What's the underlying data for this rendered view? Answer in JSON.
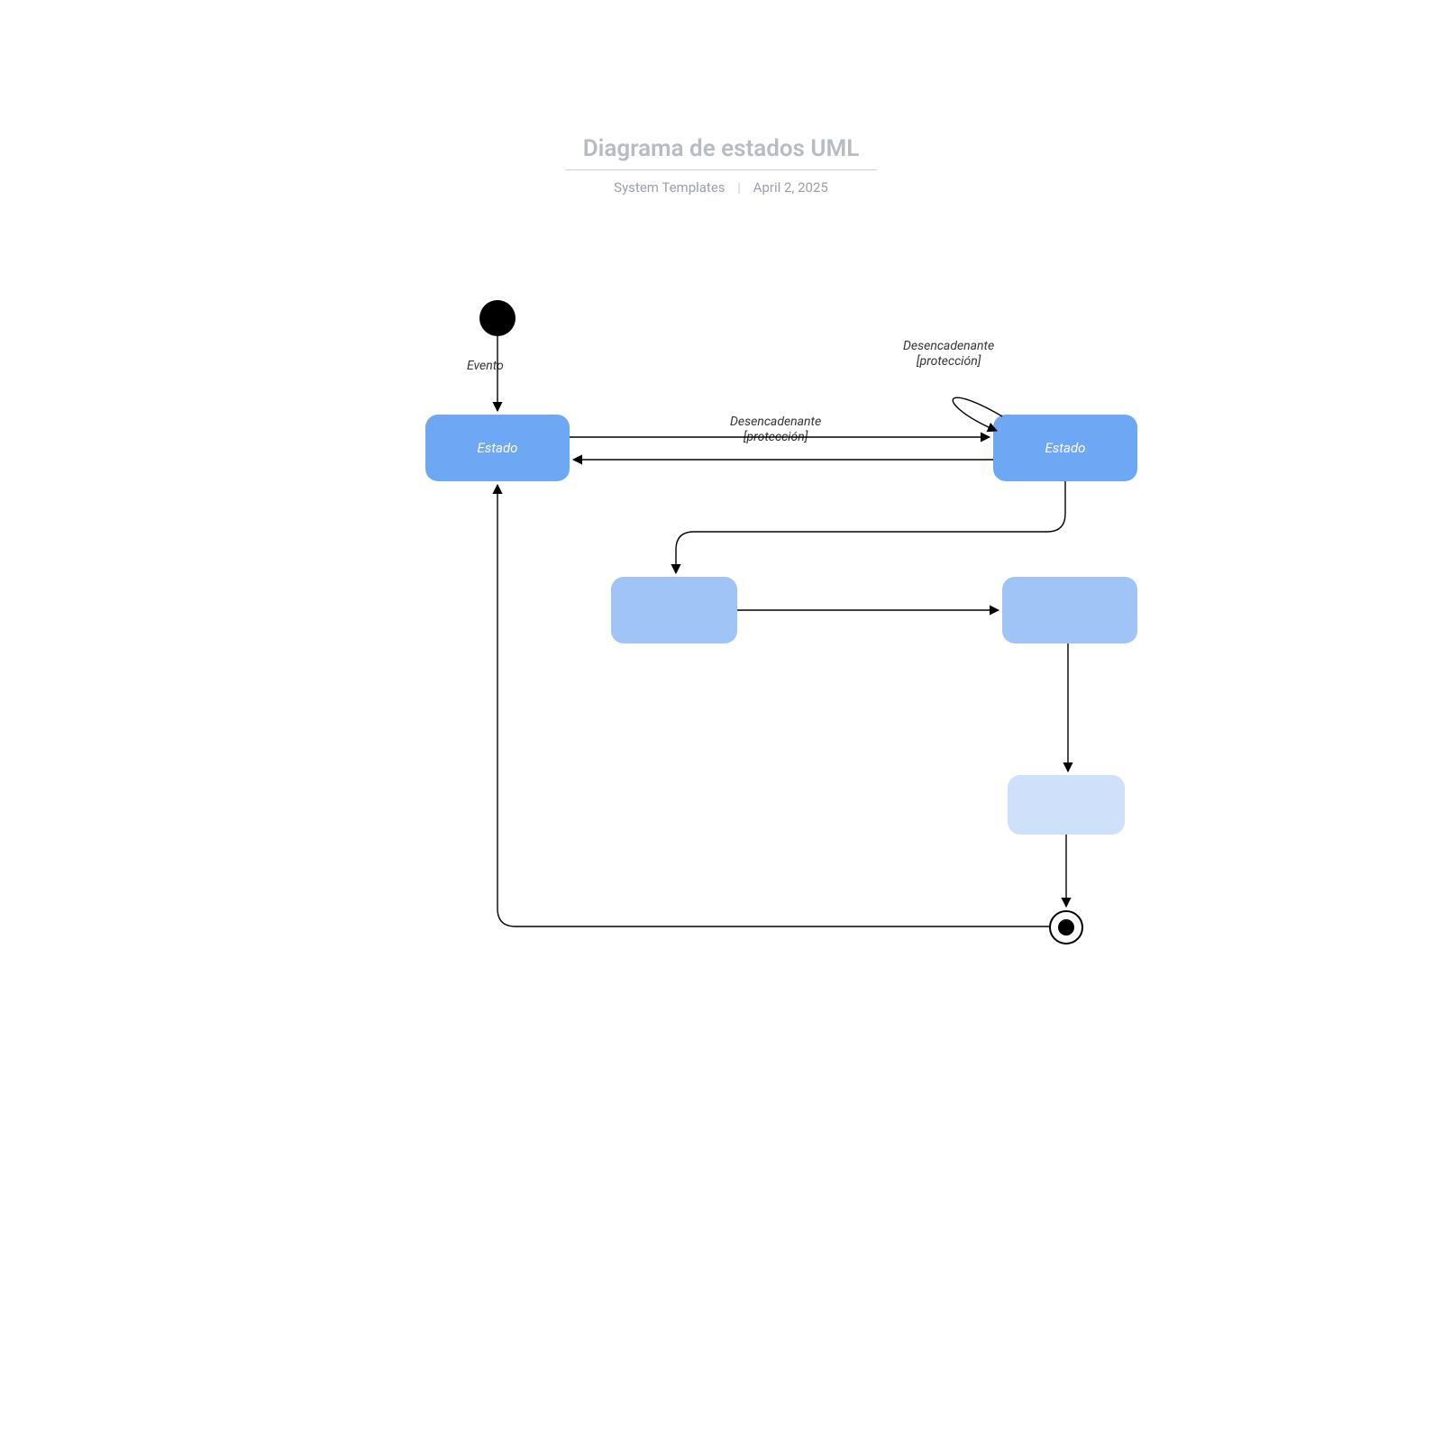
{
  "header": {
    "title": "Diagrama de estados UML",
    "author": "System Templates",
    "date": "April 2, 2025"
  },
  "nodes": {
    "state1": "Estado",
    "state2": "Estado",
    "state3": "",
    "state4": "",
    "state5": ""
  },
  "labels": {
    "evento": "Evento",
    "trigger_top_line1": "Desencadenante",
    "trigger_top_line2": "[protección]",
    "self_line1": "Desencadenante",
    "self_line2": "[protección]"
  }
}
